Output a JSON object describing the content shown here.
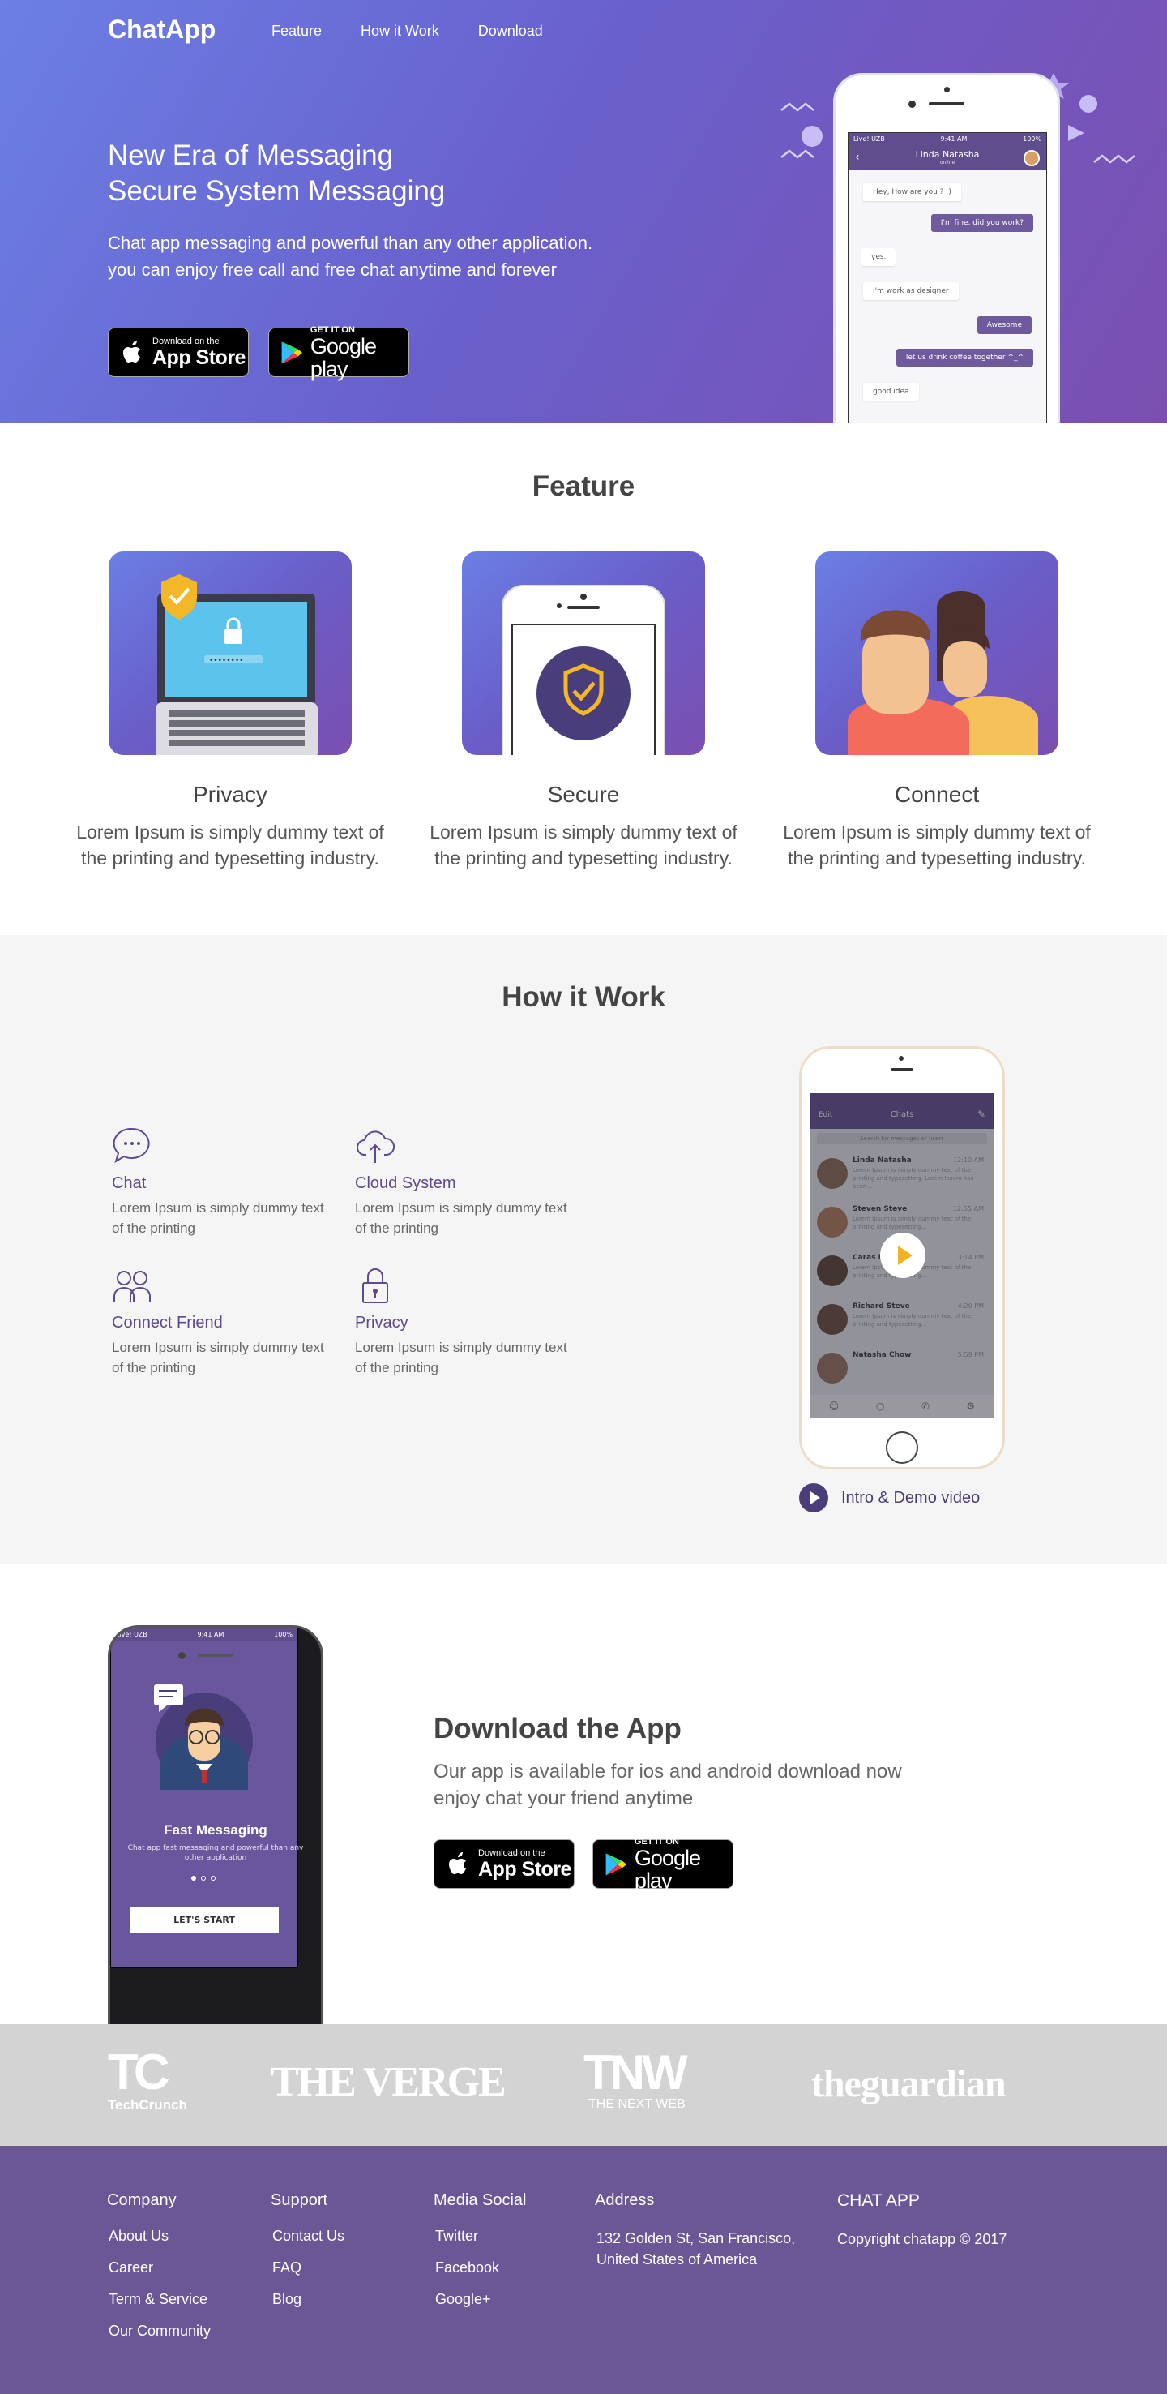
{
  "brand": "ChatApp",
  "nav": [
    "Feature",
    "How it Work",
    "Download"
  ],
  "hero": {
    "title_1": "New Era of Messaging",
    "title_2": "Secure System Messaging",
    "subtitle": "Chat app messaging and powerful than any other application. you can enjoy free call and free chat anytime and forever"
  },
  "stores": {
    "apple_small": "Download on the",
    "apple_big": "App Store",
    "google_small": "GET IT ON",
    "google_big": "Google play"
  },
  "hero_phone": {
    "status_left": "Live! UZB",
    "status_time": "9:41 AM",
    "status_right": "100%",
    "contact": "Linda Natasha",
    "contact_status": "online",
    "messages": [
      {
        "text": "Hey, How are you ? :)",
        "dir": "in"
      },
      {
        "text": "I'm fine, did you work?",
        "dir": "out"
      },
      {
        "text": "yes.",
        "dir": "in"
      },
      {
        "text": "I'm work as designer",
        "dir": "in"
      },
      {
        "text": "Awesome",
        "dir": "out"
      },
      {
        "text": "let us drink coffee together ^_^",
        "dir": "out"
      },
      {
        "text": "good idea",
        "dir": "in"
      }
    ]
  },
  "feature": {
    "title": "Feature",
    "items": [
      {
        "name": "Privacy",
        "desc": "Lorem Ipsum is simply dummy text of the printing and typesetting industry."
      },
      {
        "name": "Secure",
        "desc": "Lorem Ipsum is simply dummy text of the printing and typesetting industry."
      },
      {
        "name": "Connect",
        "desc": "Lorem Ipsum is simply dummy text of the printing and typesetting industry."
      }
    ]
  },
  "how": {
    "title": "How it Work",
    "items": [
      {
        "name": "Chat",
        "desc": "Lorem Ipsum is simply dummy text of the printing"
      },
      {
        "name": "Cloud System",
        "desc": "Lorem Ipsum is simply dummy text of the printing"
      },
      {
        "name": "Connect Friend",
        "desc": "Lorem Ipsum is simply dummy text of the printing"
      },
      {
        "name": "Privacy",
        "desc": "Lorem Ipsum is simply dummy text of the printing"
      }
    ],
    "phone": {
      "header_left": "Edit",
      "header_title": "Chats",
      "search": "Search for messages or users",
      "chats": [
        {
          "name": "Linda Natasha",
          "time": "12:10 AM",
          "preview": "Lorem Ipsum is simply dummy text of the printing and typesetting. Lorem Ipsum has been..."
        },
        {
          "name": "Steven Steve",
          "time": "12:55 AM",
          "preview": "Lorem Ipsum is simply dummy text of the printing and typesetting..."
        },
        {
          "name": "Caras Hadden",
          "time": "3:14 PM",
          "preview": "Lorem Ipsum is simply dummy text of the printing and typesetting..."
        },
        {
          "name": "Richard Steve",
          "time": "4:20 PM",
          "preview": "Lorem Ipsum is simply dummy text of the printing and typesetting..."
        },
        {
          "name": "Natasha Chow",
          "time": "5:59 PM",
          "preview": ""
        }
      ]
    },
    "intro": "Intro & Demo video"
  },
  "download": {
    "title": "Download the App",
    "subtitle": "Our app is available for ios and android download now enjoy chat your friend anytime",
    "phone": {
      "status_left": "Live! UZB",
      "status_time": "9:41 AM",
      "status_right": "100%",
      "heading": "Fast Messaging",
      "text": "Chat app fast messaging and powerful than any other application",
      "button": "LET'S START"
    }
  },
  "press": {
    "techcrunch_mark": "TC",
    "techcrunch": "TechCrunch",
    "verge": "THE VERGE",
    "tnw_mark": "TNW",
    "tnw": "THE NEXT WEB",
    "guardian": "theguardian"
  },
  "footer": {
    "company": {
      "title": "Company",
      "links": [
        "About Us",
        "Career",
        "Term & Service",
        "Our Community"
      ]
    },
    "support": {
      "title": "Support",
      "links": [
        "Contact Us",
        "FAQ",
        "Blog"
      ]
    },
    "media": {
      "title": "Media Social",
      "links": [
        "Twitter",
        "Facebook",
        "Google+"
      ]
    },
    "address": {
      "title": "Address",
      "line1": "132 Golden St, San Francisco,",
      "line2": "United States of America"
    },
    "app": {
      "title": "CHAT APP",
      "copyright": "Copyright chatapp © 2017"
    }
  },
  "colors": {
    "primary": "#6a60cc",
    "accent": "#f0b323",
    "footer": "#6b5795",
    "press": "#d3d3d3"
  }
}
